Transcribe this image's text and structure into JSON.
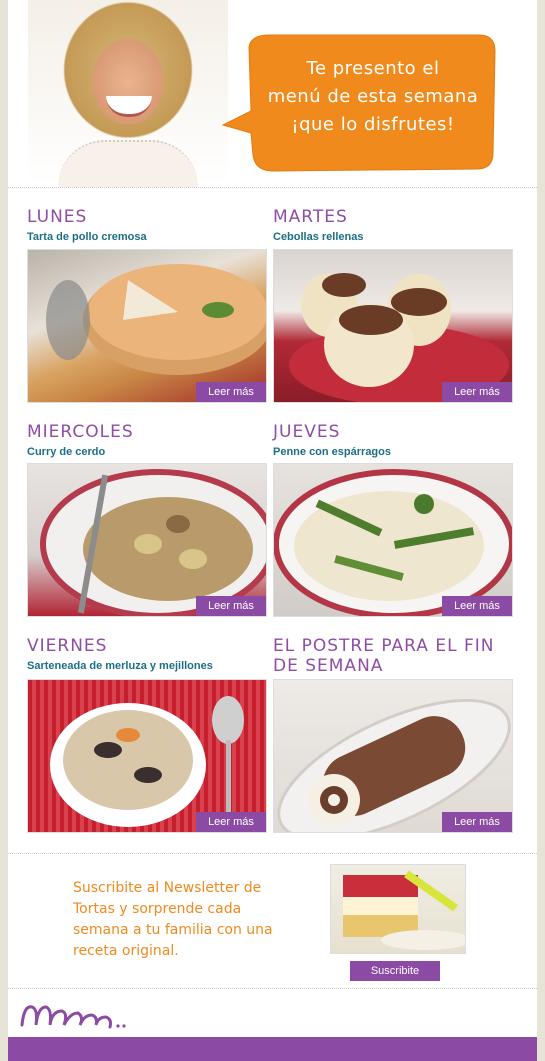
{
  "header": {
    "bubble_lines": [
      "Te presento el",
      "menú de esta semana",
      "¡que lo disfrutes!"
    ],
    "colors": {
      "bubble": "#f08a1d",
      "accent": "#8b4aa3",
      "dish": "#1c6f86"
    }
  },
  "days": [
    {
      "day": "LUNES",
      "dish": "Tarta de pollo cremosa",
      "button": "Leer más"
    },
    {
      "day": "MARTES",
      "dish": "Cebollas rellenas",
      "button": "Leer más"
    },
    {
      "day": "MIERCOLES",
      "dish": "Curry de cerdo",
      "button": "Leer más"
    },
    {
      "day": "JUEVES",
      "dish": "Penne con espárragos",
      "button": "Leer más"
    },
    {
      "day": "VIERNES",
      "dish": "Sarteneada de merluza y mejillones",
      "button": "Leer más"
    },
    {
      "day": "EL POSTRE PARA EL FIN DE SEMANA",
      "dish": "",
      "button": "Leer más"
    }
  ],
  "newsletter": {
    "text": "Suscribite al Newsletter de Tortas y sorprende cada semana a tu familia con una receta original.",
    "button": "Suscribite"
  },
  "logo": {
    "text": "mam.."
  }
}
